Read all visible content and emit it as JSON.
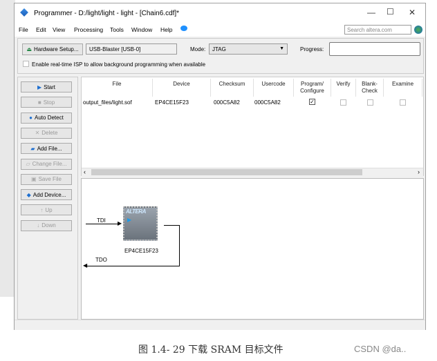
{
  "window": {
    "title": "Programmer - D:/light/light - light - [Chain6.cdf]*",
    "controls": [
      "minimize",
      "maximize",
      "close"
    ]
  },
  "menu": [
    "File",
    "Edit",
    "View",
    "Processing",
    "Tools",
    "Window",
    "Help"
  ],
  "search": {
    "placeholder": "Search altera.com"
  },
  "toolbar": {
    "hardware_setup": "Hardware Setup...",
    "hardware_value": "USB-Blaster [USB-0]",
    "mode_label": "Mode:",
    "mode_value": "JTAG",
    "progress_label": "Progress:",
    "progress": "",
    "isp_label": "Enable real-time ISP to allow background programming when available",
    "isp_checked": false
  },
  "buttons": [
    {
      "label": "Start",
      "enabled": true,
      "icon": "start-icon"
    },
    {
      "label": "Stop",
      "enabled": false,
      "icon": "stop-icon"
    },
    {
      "label": "Auto Detect",
      "enabled": true,
      "icon": "binoculars-icon"
    },
    {
      "label": "Delete",
      "enabled": false,
      "icon": "delete-icon"
    },
    {
      "label": "Add File...",
      "enabled": true,
      "icon": "add-file-icon"
    },
    {
      "label": "Change File...",
      "enabled": false,
      "icon": "change-file-icon"
    },
    {
      "label": "Save File",
      "enabled": false,
      "icon": "save-icon"
    },
    {
      "label": "Add Device...",
      "enabled": true,
      "icon": "add-device-icon"
    },
    {
      "label": "Up",
      "enabled": false,
      "icon": "up-icon"
    },
    {
      "label": "Down",
      "enabled": false,
      "icon": "down-icon"
    }
  ],
  "table": {
    "columns": [
      "File",
      "Device",
      "Checksum",
      "Usercode",
      "Program/ Configure",
      "Verify",
      "Blank- Check",
      "Examine"
    ],
    "rows": [
      {
        "file": "output_files/light.sof",
        "device": "EP4CE15F23",
        "checksum": "000C5A82",
        "usercode": "000C5A82",
        "program": true,
        "verify": false,
        "blank_check": false,
        "examine": false
      }
    ]
  },
  "diagram": {
    "tdi": "TDI",
    "tdo": "TDO",
    "device": "EP4CE15F23",
    "chip_logo": "ALTERA"
  },
  "caption": "图 1.4- 29 下载 SRAM 目标文件",
  "watermark": "CSDN @da.."
}
